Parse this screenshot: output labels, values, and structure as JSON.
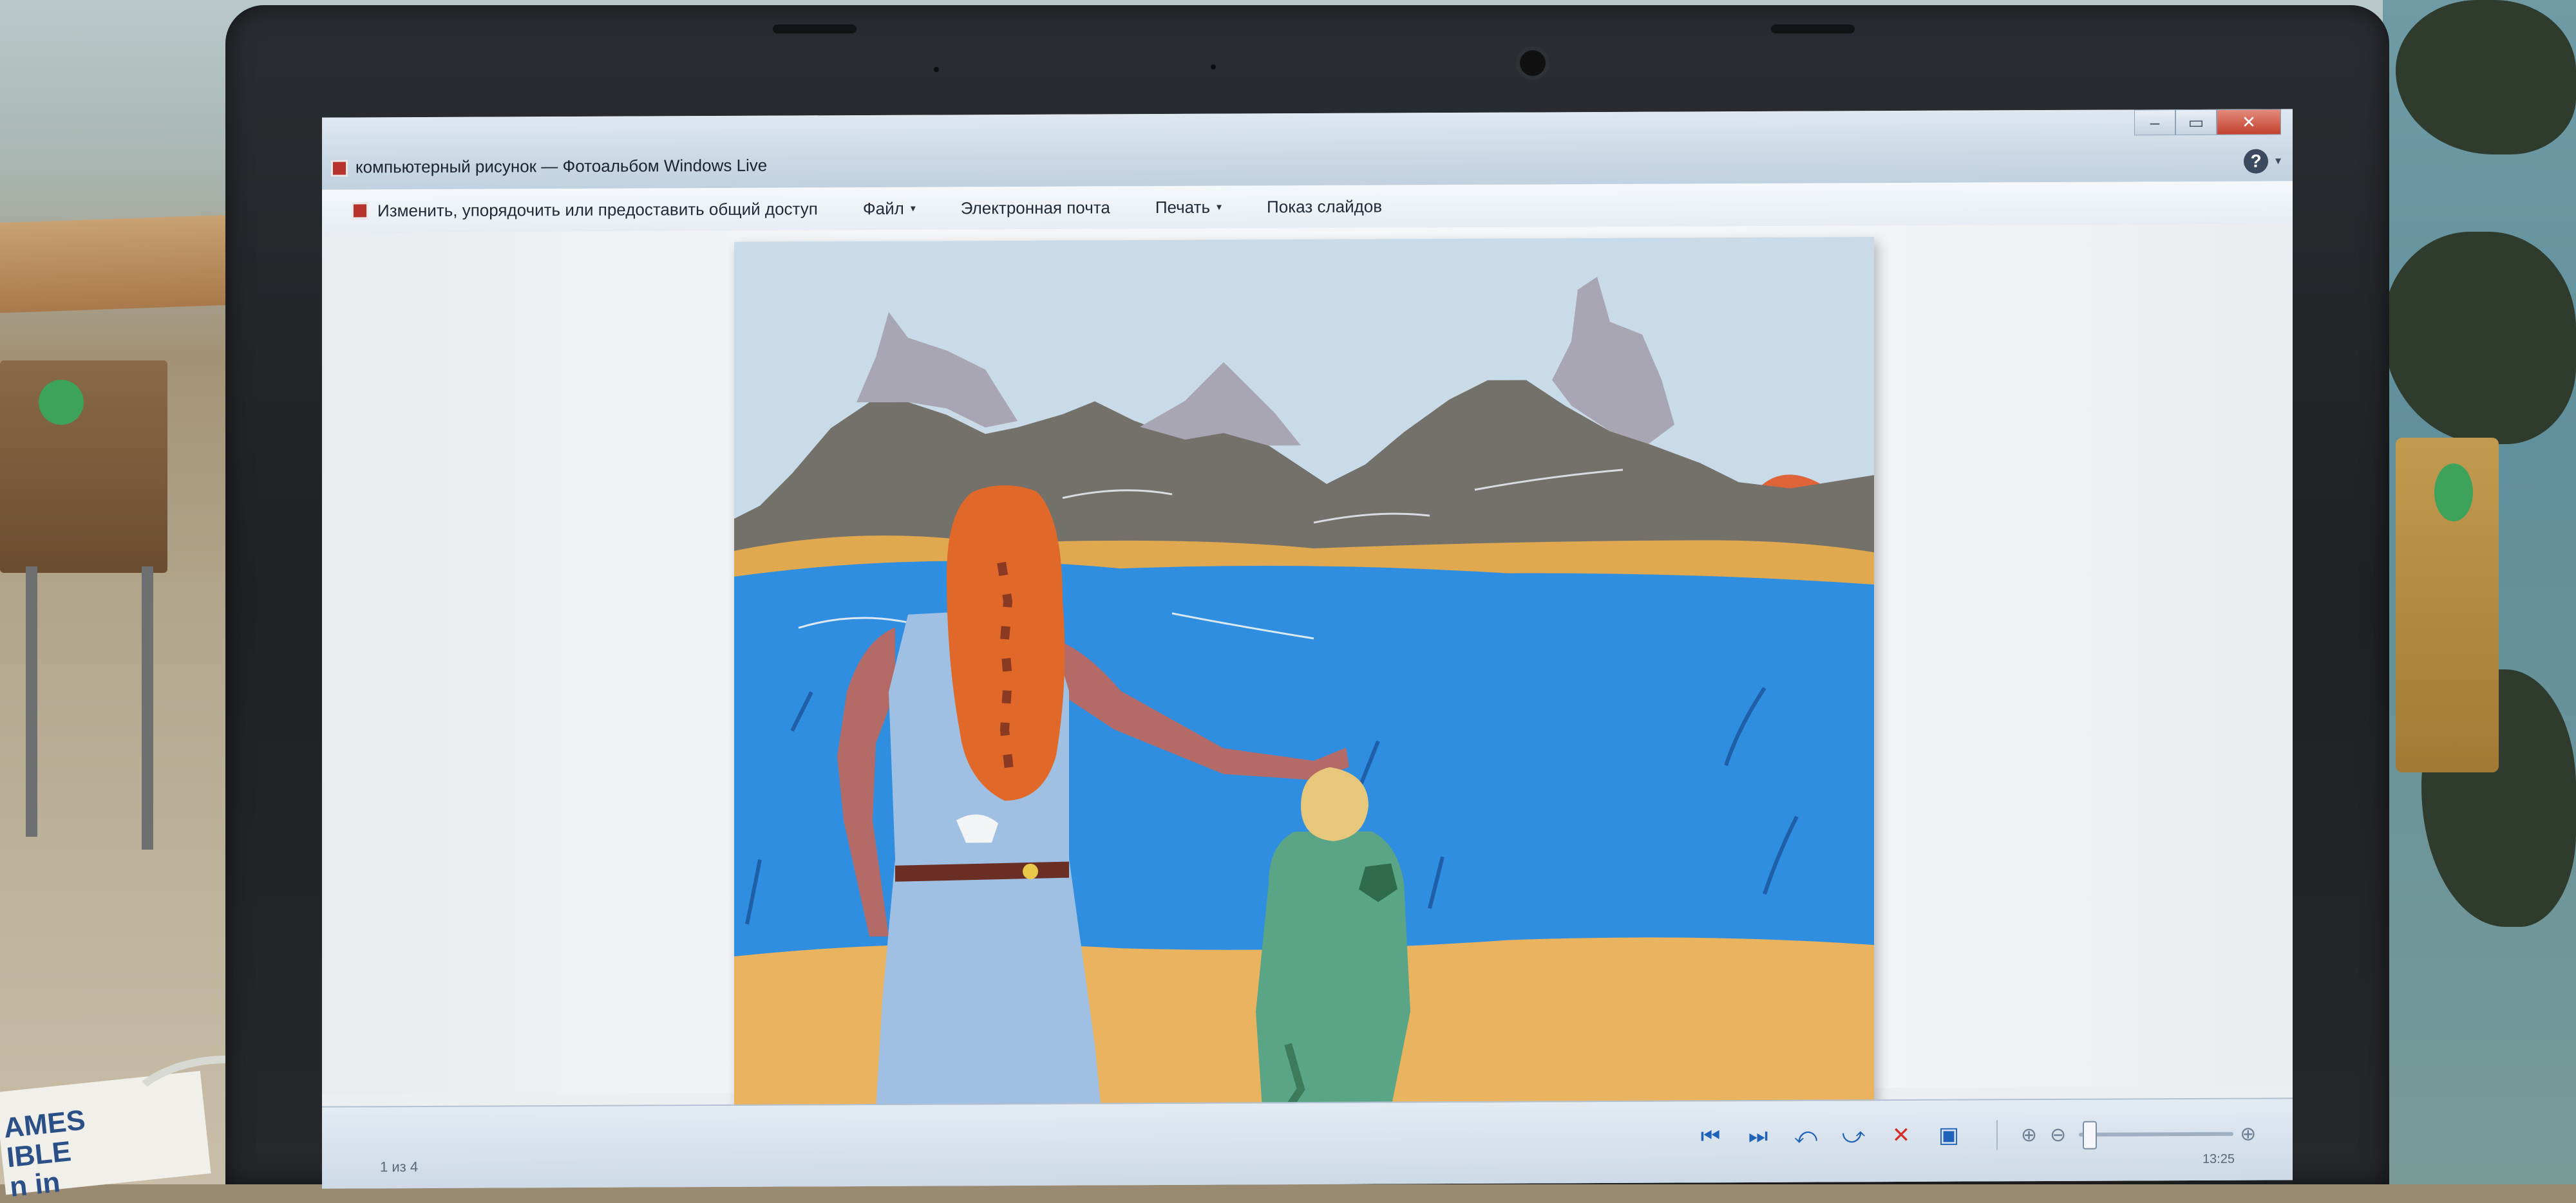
{
  "window": {
    "title": "компьютерный рисунок — Фотоальбом Windows Live",
    "minimize_glyph": "–",
    "maximize_glyph": "▭",
    "close_glyph": "✕",
    "help_glyph": "?",
    "help_caret": "▾"
  },
  "commandbar": {
    "items": [
      {
        "label": "Изменить, упорядочить или предоставить общий доступ",
        "icon": "photo-gallery-icon"
      },
      {
        "label": "Файл",
        "caret": "▾"
      },
      {
        "label": "Электронная почта"
      },
      {
        "label": "Печать",
        "caret": "▾"
      },
      {
        "label": "Показ слайдов"
      }
    ]
  },
  "statusbar": {
    "counter": "1 из 4",
    "clock": "13:25",
    "controls": {
      "first": "⏮",
      "next": "⏭",
      "rotate_left": "⤺",
      "rotate_right": "⤻",
      "delete": "✕",
      "slideshow": "▣",
      "fit": "⊕",
      "zoom_out": "⊖",
      "zoom_in": "⊕"
    }
  },
  "book": {
    "text": "AMES\nIBLE\nn in"
  },
  "colors": {
    "sky": "#c9dbe8",
    "mountain_dark": "#74716b",
    "mountain_snow": "#a8a6b2",
    "sea": "#2f8ee0",
    "sand": "#e9b35f",
    "hair": "#e0692a",
    "dress": "#9fc0e3",
    "child_shirt": "#5aa585",
    "child_hair": "#e6c77b",
    "sun": "#e0643a"
  }
}
